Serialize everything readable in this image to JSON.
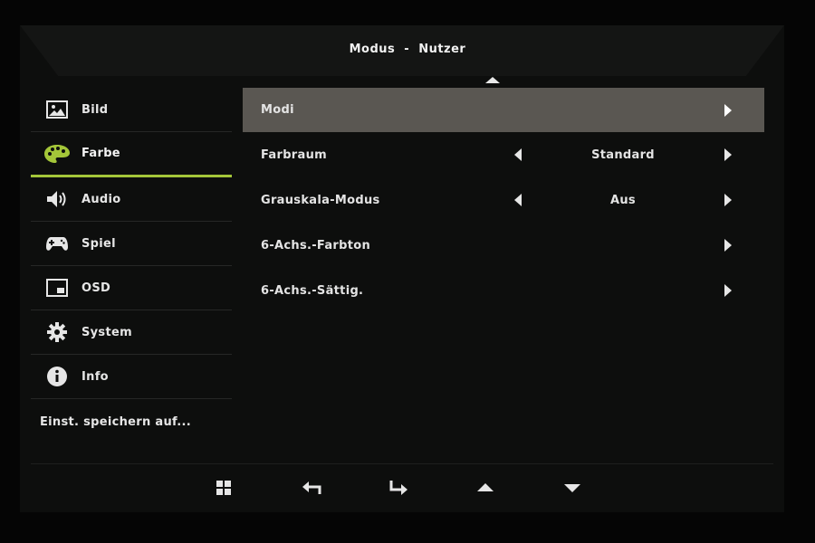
{
  "window": {
    "title_mode": "Modus",
    "title_separator": "-",
    "title_value": "Nutzer"
  },
  "sidebar": {
    "items": [
      {
        "label": "Bild",
        "icon": "picture-icon",
        "active": false
      },
      {
        "label": "Farbe",
        "icon": "palette-icon",
        "active": true
      },
      {
        "label": "Audio",
        "icon": "speaker-icon",
        "active": false
      },
      {
        "label": "Spiel",
        "icon": "gamepad-icon",
        "active": false
      },
      {
        "label": "OSD",
        "icon": "osd-window-icon",
        "active": false
      },
      {
        "label": "System",
        "icon": "gear-icon",
        "active": false
      },
      {
        "label": "Info",
        "icon": "info-icon",
        "active": false
      }
    ],
    "save_label": "Einst. speichern auf..."
  },
  "main": {
    "rows": [
      {
        "label": "Modi",
        "value": "",
        "selected": true
      },
      {
        "label": "Farbraum",
        "value": "Standard",
        "selected": false
      },
      {
        "label": "Grauskala-Modus",
        "value": "Aus",
        "selected": false
      },
      {
        "label": "6-Achs.-Farbton",
        "value": "",
        "selected": false
      },
      {
        "label": "6-Achs.-Sättig.",
        "value": "",
        "selected": false
      }
    ]
  },
  "footer": {
    "buttons": [
      "menu-grid-icon",
      "back-icon",
      "enter-icon",
      "up-arrow-icon",
      "down-arrow-icon"
    ]
  },
  "colors": {
    "accent": "#a4c639",
    "selected_row": "#5a5752",
    "background": "#0d0e0d"
  }
}
